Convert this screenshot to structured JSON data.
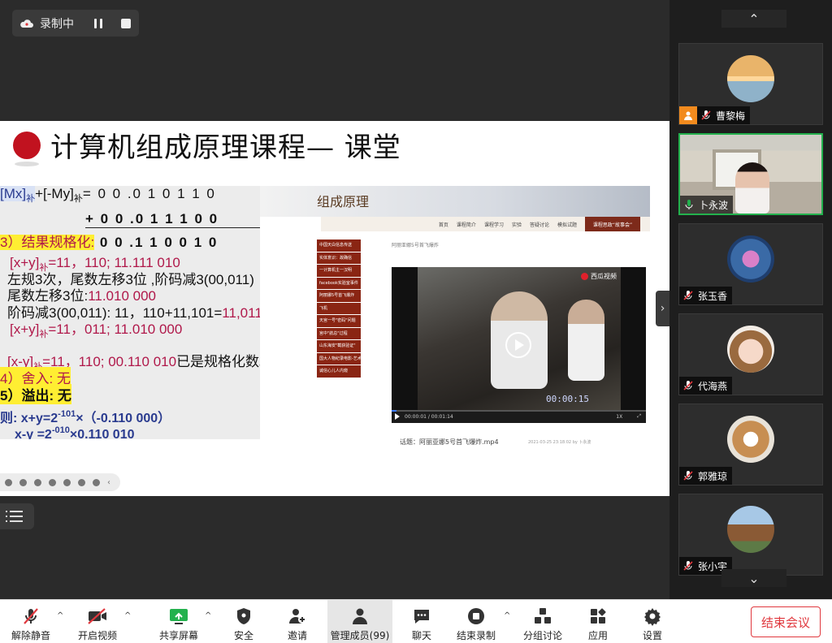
{
  "recording": {
    "status": "录制中"
  },
  "slide": {
    "title": "计算机组成原理课程— 课堂",
    "math": {
      "l1a": "[Mx]",
      "l1b": "补",
      "l1c": "+[-My]",
      "l1d": "补",
      "l1e": "= 0 0 .0 1 0  1 1 0",
      "l2": "+ 0 0 .0 1 1  1 0 0",
      "l3a": "3）结果规格化:",
      "l3b": " 0 0 .1 1 0  0 1 0",
      "l4a": "[x+y]",
      "l4b": "补",
      "l4c": "=11，110;  11.111  010",
      "l5": "左规3次，尾数左移3位 ,阶码减3(00,011)",
      "l6a": "尾数左移3位:",
      "l6b": "11.010  000",
      "l7a": "阶码减3(00,011): 11，110+11,101=",
      "l7b": "11,011",
      "l8a": "[x+y]",
      "l8b": "补",
      "l8c": "=11，011;  11.010  000",
      "l9a": "[x-y]",
      "l9b": "补",
      "l9c": "=11，110;  00.110  010",
      "l9d": "已是规格化数。",
      "l10": "4）舍入: 无",
      "l11": "5）溢出: 无",
      "l12a": "则:  x+y=2",
      "l12b": "-101",
      "l12c": "×（-0.110  000）",
      "l13a": "x-y =2",
      "l13b": "-010",
      "l13c": "×0.110  010"
    },
    "web": {
      "banner_title": "组成原理",
      "nav": [
        "首页",
        "课程简介",
        "课程学习",
        "实验",
        "答疑讨论",
        "模拟试题"
      ],
      "nav_active": "课程思政“故事会”",
      "side_menu": [
        "中国天白信息传送",
        "实体意识：故确信",
        "一计算机主一汉明",
        "facebook实验室事件",
        "阿丽娜5号首飞爆炸",
        "飞机",
        "天宫一号\"密码\"问题",
        "宫中\"航总\"过程",
        "山东海安\"截获验证\"",
        "国大人物纪录电影-艺术",
        "诚信心儿人内窥"
      ],
      "crumb": "阿丽亚娜5号首飞爆炸",
      "video_badge": "西瓜视频",
      "timecode": "00:00:15",
      "time": "00:00:01 / 00:01:14",
      "speed": "1X",
      "progress": 0.02,
      "caption": "话题：阿丽亚娜5号首飞爆炸.mp4",
      "caption_meta": "2021-03-25 23:18:02   by  卜永波"
    }
  },
  "participants": [
    {
      "name": "曹黎梅",
      "host": true,
      "muted": true
    },
    {
      "name": "卜永波",
      "host": false,
      "muted": false,
      "video": true
    },
    {
      "name": "张玉香",
      "host": false,
      "muted": true
    },
    {
      "name": "代海燕",
      "host": false,
      "muted": true
    },
    {
      "name": "郭雅琼",
      "host": false,
      "muted": true
    },
    {
      "name": "张小宇",
      "host": false,
      "muted": true
    }
  ],
  "toolbar": {
    "unmute": "解除静音",
    "video": "开启视频",
    "share": "共享屏幕",
    "security": "安全",
    "invite": "邀请",
    "members": "管理成员(99)",
    "chat": "聊天",
    "stop_rec": "结束录制",
    "breakout": "分组讨论",
    "apps": "应用",
    "settings": "设置",
    "end": "结束会议"
  },
  "colors": {
    "accent_green": "#23b14d",
    "end_red": "#e0383e",
    "host_orange": "#f28b1e"
  }
}
